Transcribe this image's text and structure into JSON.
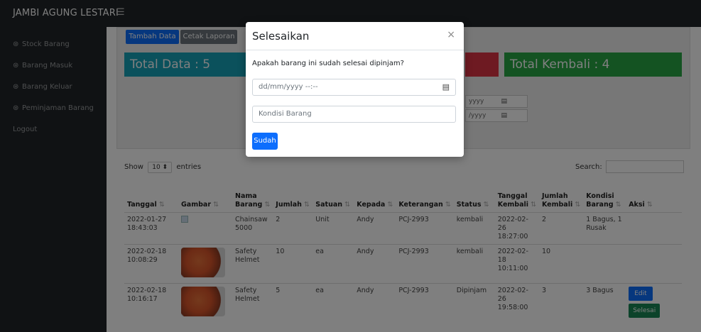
{
  "app": {
    "brand": "JAMBI AGUNG LESTARI",
    "menu_icon": "☰"
  },
  "sidebar": {
    "items": [
      {
        "label": "Stock Barang",
        "icon": "tachometer-icon"
      },
      {
        "label": "Barang Masuk",
        "icon": "tachometer-icon"
      },
      {
        "label": "Barang Keluar",
        "icon": "tachometer-icon"
      },
      {
        "label": "Peminjaman Barang",
        "icon": "tachometer-icon"
      },
      {
        "label": "Logout"
      }
    ]
  },
  "toolbar": {
    "tambah_label": "Tambah Data",
    "cetak_label": "Cetak Laporan"
  },
  "stats": {
    "total_data": "Total Data : 5",
    "total_kembali": "Total Kembali : 4"
  },
  "filters": {
    "date_fragment_1": "yyyy",
    "date_fragment_2": "/yyyy"
  },
  "table_controls": {
    "show": "Show",
    "entries_value": "10",
    "entries": "entries",
    "search_label": "Search:"
  },
  "table": {
    "headers": [
      "Tanggal",
      "Gambar",
      "Nama Barang",
      "Jumlah",
      "Satuan",
      "Kepada",
      "Keterangan",
      "Status",
      "Tanggal Kembali",
      "Jumlah Kembali",
      "Kondisi Barang",
      "Aksi"
    ],
    "rows": [
      {
        "tanggal": "2022-01-27 18:43:03",
        "nama": "Chainsaw 5000",
        "jumlah": "2",
        "satuan": "Unit",
        "kepada": "Andy",
        "keterangan": "PCJ-2993",
        "status": "kembali",
        "tgl_kembali": "2022-02-26 18:27:00",
        "jml_kembali": "2",
        "kondisi": "1 Bagus, 1 Rusak"
      },
      {
        "tanggal": "2022-02-18 10:08:29",
        "nama": "Safety Helmet",
        "jumlah": "10",
        "satuan": "ea",
        "kepada": "Andy",
        "keterangan": "PCJ-2993",
        "status": "kembali",
        "tgl_kembali": "2022-02-18 10:11:00",
        "jml_kembali": "10",
        "kondisi": ""
      },
      {
        "tanggal": "2022-02-18 10:16:17",
        "nama": "Safety Helmet",
        "jumlah": "5",
        "satuan": "ea",
        "kepada": "Andy",
        "keterangan": "PCJ-2993",
        "status": "Dipinjam",
        "tgl_kembali": "2022-02-26 19:58:00",
        "jml_kembali": "3",
        "kondisi": "3 Bagus",
        "edit_label": "Edit",
        "selesai_label": "Selesai"
      }
    ]
  },
  "modal": {
    "title": "Selesaikan",
    "close": "×",
    "question": "Apakah barang ini sudah selesai dipinjam?",
    "date_placeholder": "dd/mm/yyyy --:--",
    "kondisi_placeholder": "Kondisi Barang",
    "submit_label": "Sudah"
  },
  "colors": {
    "primary": "#0d6efd",
    "info": "#17a2b8",
    "danger": "#dc3545",
    "success": "#28a745",
    "sidebar": "#212529"
  }
}
